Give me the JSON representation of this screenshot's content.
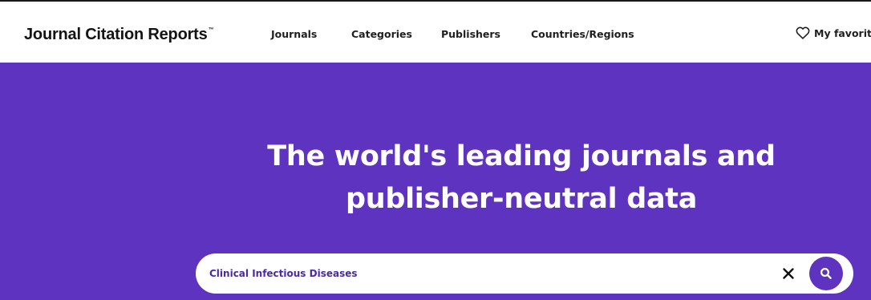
{
  "header": {
    "brand": "Journal Citation Reports",
    "brand_trademark": "™",
    "nav": {
      "journals": "Journals",
      "categories": "Categories",
      "publishers": "Publishers",
      "countries": "Countries/Regions"
    },
    "favorites_label": "My favorite",
    "favorites_icon": "heart-icon"
  },
  "hero": {
    "title_line1": "The world's leading journals and",
    "title_line2": "publisher-neutral data"
  },
  "search": {
    "value": "Clinical Infectious Diseases",
    "clear_icon": "close-icon",
    "submit_icon": "search-icon"
  },
  "colors": {
    "hero_background": "#5e33bf",
    "search_text": "#4a2aa8",
    "header_background": "#ffffff"
  }
}
